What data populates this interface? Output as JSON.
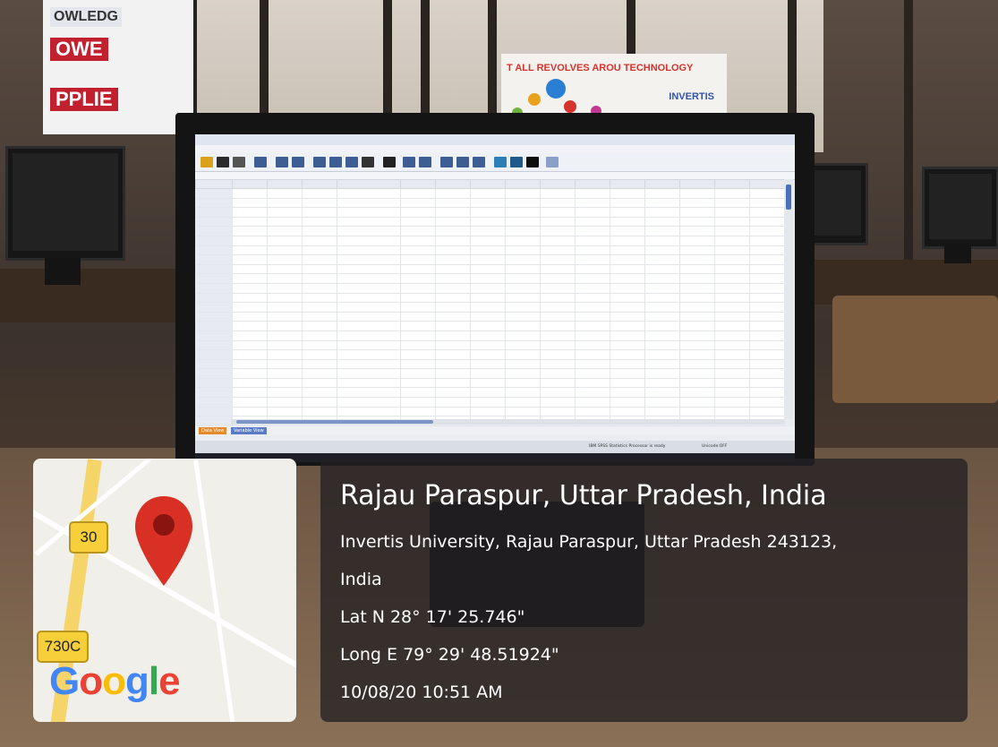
{
  "background": {
    "poster_left_lines": [
      "OWLEDG",
      "OWE",
      "PPLIE"
    ],
    "banner_text": "T ALL REVOLVES AROU    TECHNOLOGY",
    "banner_brand": "INVERTIS"
  },
  "spss": {
    "status_text": "IBM SPSS Statistics Processor is ready",
    "unicode_text": "Unicode:OFF",
    "tabs": [
      "Data View",
      "Variable View"
    ]
  },
  "map": {
    "shields": [
      "30",
      "730C"
    ],
    "logo_letters": [
      "G",
      "o",
      "o",
      "g",
      "l",
      "e"
    ]
  },
  "location": {
    "title": "Rajau Paraspur, Uttar Pradesh, India",
    "address_line1": "Invertis University, Rajau Paraspur, Uttar Pradesh 243123,",
    "address_line2": "India",
    "lat": "Lat N 28° 17' 25.746\"",
    "long": "Long E 79° 29' 48.51924\"",
    "datetime": "10/08/20 10:51 AM"
  },
  "colors": {
    "pin": "#d93025",
    "overlay": "#232022",
    "spss_blue": "#3d5d93"
  }
}
